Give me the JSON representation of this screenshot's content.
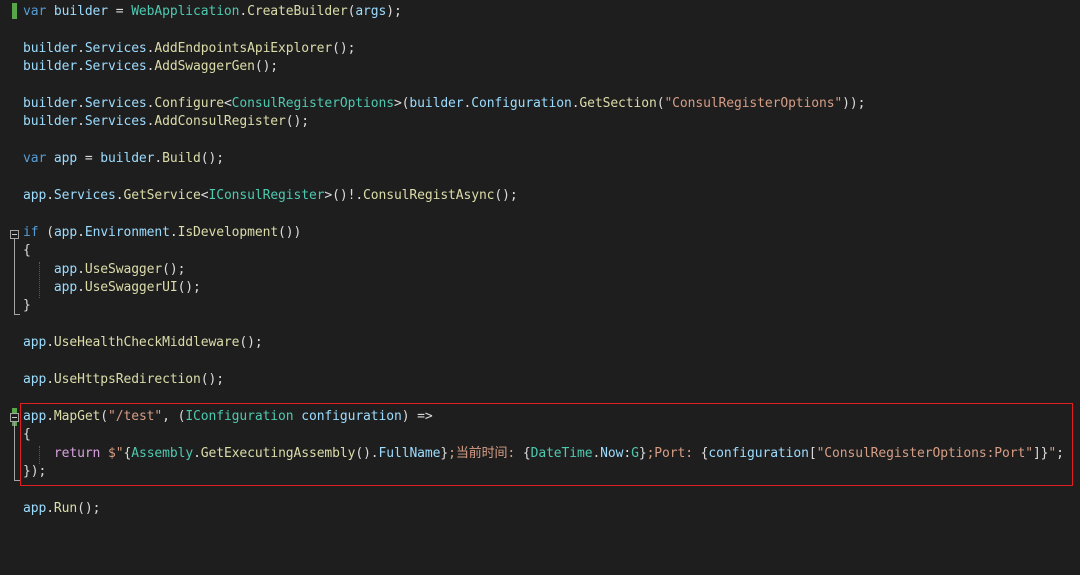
{
  "editor": {
    "language": "C#",
    "highlight_color": "#e02020",
    "colors": {
      "background": "#1e1e1e",
      "keyword": "#569cd6",
      "identifier": "#9cdcfe",
      "type": "#4ec9b0",
      "method": "#dcdcaa",
      "string": "#d69d85",
      "punctuation": "#dcdcdc",
      "control": "#d8a0df",
      "change_marker": "#57a64a"
    },
    "lines": [
      [
        [
          "kw",
          "var"
        ],
        [
          "pn",
          " "
        ],
        [
          "id",
          "builder"
        ],
        [
          "pn",
          " = "
        ],
        [
          "ty",
          "WebApplication"
        ],
        [
          "pn",
          "."
        ],
        [
          "mt",
          "CreateBuilder"
        ],
        [
          "pn",
          "("
        ],
        [
          "id",
          "args"
        ],
        [
          "pn",
          ");"
        ]
      ],
      [],
      [
        [
          "id",
          "builder"
        ],
        [
          "pn",
          "."
        ],
        [
          "id",
          "Services"
        ],
        [
          "pn",
          "."
        ],
        [
          "mt",
          "AddEndpointsApiExplorer"
        ],
        [
          "pn",
          "();"
        ]
      ],
      [
        [
          "id",
          "builder"
        ],
        [
          "pn",
          "."
        ],
        [
          "id",
          "Services"
        ],
        [
          "pn",
          "."
        ],
        [
          "mt",
          "AddSwaggerGen"
        ],
        [
          "pn",
          "();"
        ]
      ],
      [],
      [
        [
          "id",
          "builder"
        ],
        [
          "pn",
          "."
        ],
        [
          "id",
          "Services"
        ],
        [
          "pn",
          "."
        ],
        [
          "mt",
          "Configure"
        ],
        [
          "pn",
          "<"
        ],
        [
          "ty",
          "ConsulRegisterOptions"
        ],
        [
          "pn",
          ">("
        ],
        [
          "id",
          "builder"
        ],
        [
          "pn",
          "."
        ],
        [
          "id",
          "Configuration"
        ],
        [
          "pn",
          "."
        ],
        [
          "mt",
          "GetSection"
        ],
        [
          "pn",
          "("
        ],
        [
          "st",
          "\"ConsulRegisterOptions\""
        ],
        [
          "pn",
          "));"
        ]
      ],
      [
        [
          "id",
          "builder"
        ],
        [
          "pn",
          "."
        ],
        [
          "id",
          "Services"
        ],
        [
          "pn",
          "."
        ],
        [
          "mt",
          "AddConsulRegister"
        ],
        [
          "pn",
          "();"
        ]
      ],
      [],
      [
        [
          "kw",
          "var"
        ],
        [
          "pn",
          " "
        ],
        [
          "id",
          "app"
        ],
        [
          "pn",
          " = "
        ],
        [
          "id",
          "builder"
        ],
        [
          "pn",
          "."
        ],
        [
          "mt",
          "Build"
        ],
        [
          "pn",
          "();"
        ]
      ],
      [],
      [
        [
          "id",
          "app"
        ],
        [
          "pn",
          "."
        ],
        [
          "id",
          "Services"
        ],
        [
          "pn",
          "."
        ],
        [
          "mt",
          "GetService"
        ],
        [
          "pn",
          "<"
        ],
        [
          "ty",
          "IConsulRegister"
        ],
        [
          "pn",
          ">()!."
        ],
        [
          "mt",
          "ConsulRegistAsync"
        ],
        [
          "pn",
          "();"
        ]
      ],
      [],
      [
        [
          "kw",
          "if"
        ],
        [
          "pn",
          " ("
        ],
        [
          "id",
          "app"
        ],
        [
          "pn",
          "."
        ],
        [
          "id",
          "Environment"
        ],
        [
          "pn",
          "."
        ],
        [
          "mt",
          "IsDevelopment"
        ],
        [
          "pn",
          "())"
        ]
      ],
      [
        [
          "pn",
          "{"
        ]
      ],
      [
        [
          "pn",
          "    "
        ],
        [
          "id",
          "app"
        ],
        [
          "pn",
          "."
        ],
        [
          "mt",
          "UseSwagger"
        ],
        [
          "pn",
          "();"
        ]
      ],
      [
        [
          "pn",
          "    "
        ],
        [
          "id",
          "app"
        ],
        [
          "pn",
          "."
        ],
        [
          "mt",
          "UseSwaggerUI"
        ],
        [
          "pn",
          "();"
        ]
      ],
      [
        [
          "pn",
          "}"
        ]
      ],
      [],
      [
        [
          "id",
          "app"
        ],
        [
          "pn",
          "."
        ],
        [
          "mt",
          "UseHealthCheckMiddleware"
        ],
        [
          "pn",
          "();"
        ]
      ],
      [],
      [
        [
          "id",
          "app"
        ],
        [
          "pn",
          "."
        ],
        [
          "mt",
          "UseHttpsRedirection"
        ],
        [
          "pn",
          "();"
        ]
      ],
      [],
      [
        [
          "id",
          "app"
        ],
        [
          "pn",
          "."
        ],
        [
          "mt",
          "MapGet"
        ],
        [
          "pn",
          "("
        ],
        [
          "st",
          "\"/test\""
        ],
        [
          "pn",
          ", ("
        ],
        [
          "ty",
          "IConfiguration"
        ],
        [
          "pn",
          " "
        ],
        [
          "id",
          "configuration"
        ],
        [
          "pn",
          ") =>"
        ]
      ],
      [
        [
          "pn",
          "{"
        ]
      ],
      [
        [
          "pn",
          "    "
        ],
        [
          "cf",
          "return"
        ],
        [
          "pn",
          " "
        ],
        [
          "st",
          "$\""
        ],
        [
          "pn",
          "{"
        ],
        [
          "ty",
          "Assembly"
        ],
        [
          "pn",
          "."
        ],
        [
          "mt",
          "GetExecutingAssembly"
        ],
        [
          "pn",
          "()."
        ],
        [
          "id",
          "FullName"
        ],
        [
          "pn",
          "}"
        ],
        [
          "st",
          ";当前时间: "
        ],
        [
          "pn",
          "{"
        ],
        [
          "ty",
          "DateTime"
        ],
        [
          "pn",
          "."
        ],
        [
          "id",
          "Now"
        ],
        [
          "pn",
          ":"
        ],
        [
          "hole",
          "G"
        ],
        [
          "pn",
          "}"
        ],
        [
          "st",
          ";Port: "
        ],
        [
          "pn",
          "{"
        ],
        [
          "id",
          "configuration"
        ],
        [
          "pn",
          "["
        ],
        [
          "st",
          "\"ConsulRegisterOptions:Port\""
        ],
        [
          "pn",
          "]}"
        ],
        [
          "st",
          "\""
        ],
        [
          "pn",
          ";"
        ]
      ],
      [
        [
          "pn",
          "});"
        ]
      ],
      [],
      [
        [
          "id",
          "app"
        ],
        [
          "pn",
          "."
        ],
        [
          "mt",
          "Run"
        ],
        [
          "pn",
          "();"
        ]
      ]
    ]
  }
}
